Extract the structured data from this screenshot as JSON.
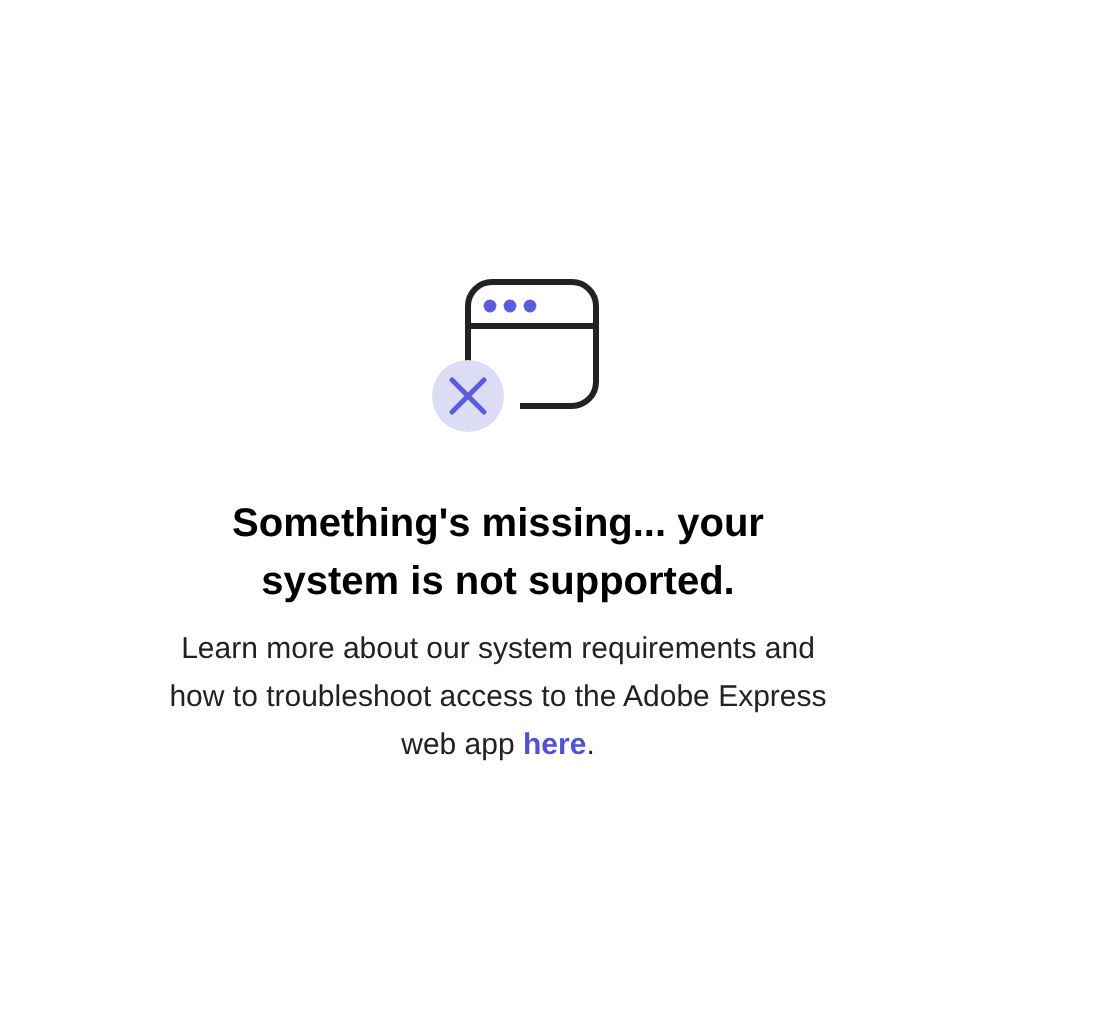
{
  "title": "Something's missing... your system is not supported.",
  "message": {
    "text": "Learn more about our system requirements and how to troubleshoot access to the Adobe Express web app ",
    "link": "here",
    "end": "."
  }
}
